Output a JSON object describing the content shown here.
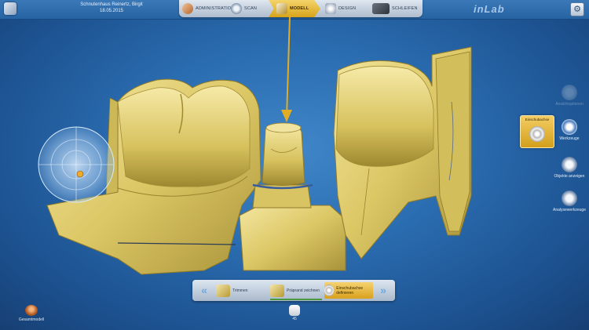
{
  "header": {
    "patient_name": "Schnutenhaus Reinertz, Birgit",
    "date": "18.05.2015",
    "brand": "inLab"
  },
  "phases": [
    {
      "label": "ADMINISTRATION",
      "icon": "administration-icon"
    },
    {
      "label": "SCAN",
      "icon": "scan-icon"
    },
    {
      "label": "MODELL",
      "icon": "model-icon",
      "active": true
    },
    {
      "label": "DESIGN",
      "icon": "design-icon"
    },
    {
      "label": "SCHLEIFEN",
      "icon": "milling-icon"
    }
  ],
  "right_panel": {
    "active_tool_label": "Einschubachse",
    "items": [
      {
        "label": "Ansichtoptionen",
        "icon": "view-options-icon",
        "disabled": true
      },
      {
        "label": "Werkzeuge",
        "icon": "tools-icon"
      },
      {
        "label": "Objekte anzeigen",
        "icon": "show-objects-icon"
      },
      {
        "label": "Analysewerkzeuge",
        "icon": "analysis-tools-icon"
      }
    ]
  },
  "steps": [
    {
      "label": "Trimmen",
      "icon": "trim-icon"
    },
    {
      "label": "Präprand zeichnen",
      "icon": "margin-draw-icon",
      "done": true
    },
    {
      "label": "Einschubachse definieren",
      "icon": "insertion-axis-icon",
      "active": true
    }
  ],
  "bottom_left": {
    "label": "Gesamtmodell",
    "icon": "full-model-icon"
  },
  "bottom_center": {
    "label": "45",
    "icon": "tooth-icon"
  },
  "colors": {
    "accent": "#e2ad24",
    "background": "#2a6cb0",
    "model": "#e8d67a"
  }
}
